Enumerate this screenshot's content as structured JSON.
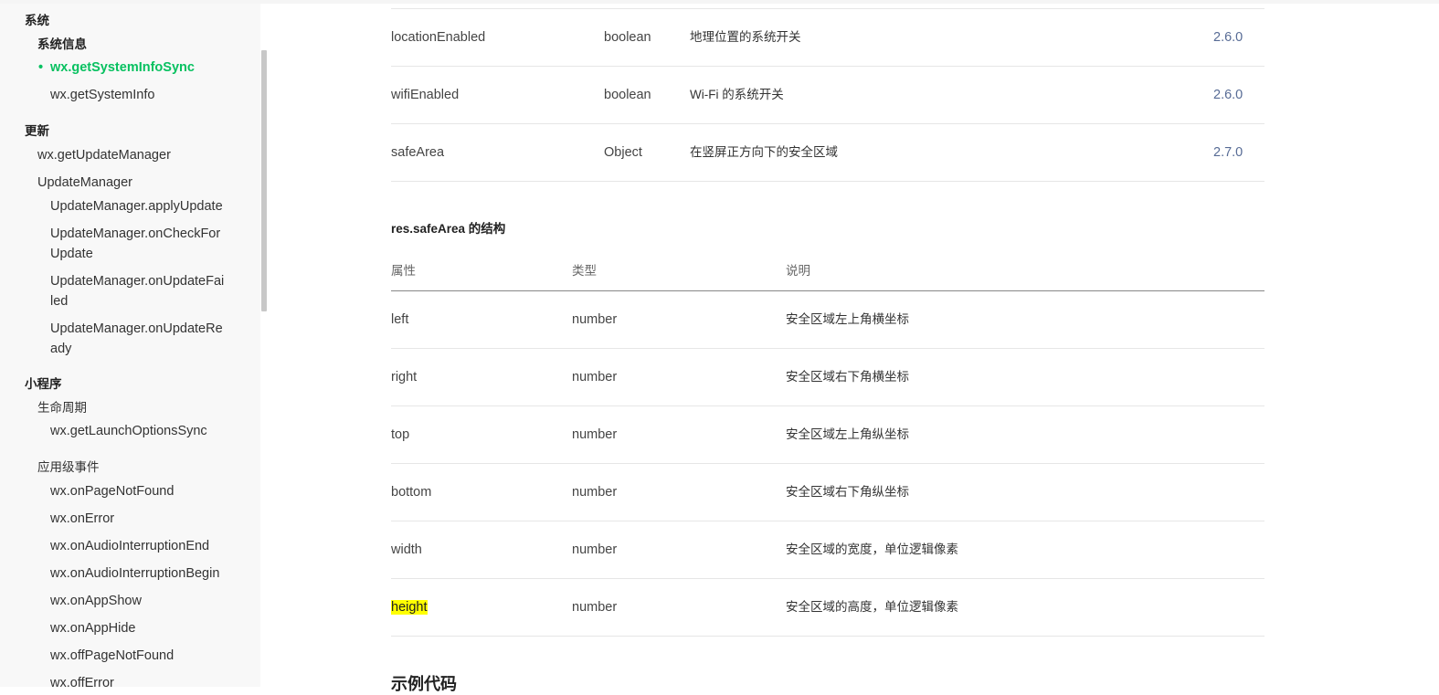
{
  "sidebar": {
    "sections": [
      {
        "label": "系统"
      },
      {
        "label": "更新"
      },
      {
        "label": "小程序"
      }
    ],
    "system_info": "系统信息",
    "active_item": "wx.getSystemInfoSync",
    "get_system_info": "wx.getSystemInfo",
    "get_update_manager": "wx.getUpdateManager",
    "update_manager": "UpdateManager",
    "apply_update": "UpdateManager.applyUpdate",
    "on_check_1": "UpdateManager.onCheckFor",
    "on_check_2": "Update",
    "on_failed_1": "UpdateManager.onUpdateFai",
    "on_failed_2": "led",
    "on_ready_1": "UpdateManager.onUpdateRe",
    "on_ready_2": "ady",
    "lifecycle": "生命周期",
    "launch_options": "wx.getLaunchOptionsSync",
    "app_events": "应用级事件",
    "events": [
      "wx.onPageNotFound",
      "wx.onError",
      "wx.onAudioInterruptionEnd",
      "wx.onAudioInterruptionBegin",
      "wx.onAppShow",
      "wx.onAppHide",
      "wx.offPageNotFound",
      "wx.offError"
    ]
  },
  "top_table": {
    "rows": [
      {
        "name": "locationEnabled",
        "type": "boolean",
        "desc": "地理位置的系统开关",
        "version": "2.6.0"
      },
      {
        "name": "wifiEnabled",
        "type": "boolean",
        "desc": "Wi-Fi 的系统开关",
        "version": "2.6.0"
      },
      {
        "name": "safeArea",
        "type": "Object",
        "desc": "在竖屏正方向下的安全区域",
        "version": "2.7.0"
      }
    ]
  },
  "safe_area": {
    "title": "res.safeArea 的结构",
    "headers": {
      "property": "属性",
      "type": "类型",
      "description": "说明"
    },
    "rows": [
      {
        "name": "left",
        "type": "number",
        "desc": "安全区域左上角横坐标"
      },
      {
        "name": "right",
        "type": "number",
        "desc": "安全区域右下角横坐标"
      },
      {
        "name": "top",
        "type": "number",
        "desc": "安全区域左上角纵坐标"
      },
      {
        "name": "bottom",
        "type": "number",
        "desc": "安全区域右下角纵坐标"
      },
      {
        "name": "width",
        "type": "number",
        "desc": "安全区域的宽度，单位逻辑像素"
      },
      {
        "name": "height",
        "type": "number",
        "desc": "安全区域的高度，单位逻辑像素"
      }
    ]
  },
  "next_section": {
    "title": "示例代码"
  },
  "colors": {
    "accent": "#07c160",
    "version_link": "#576b95",
    "highlight": "#ffff00"
  }
}
